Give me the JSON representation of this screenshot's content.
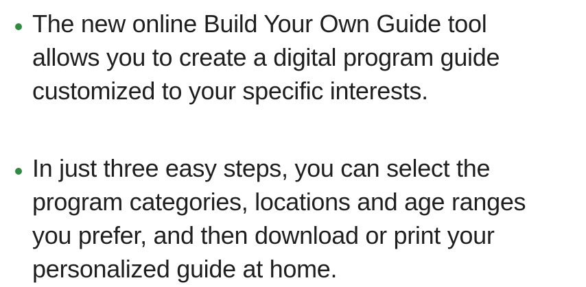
{
  "colors": {
    "bullet": "#2e8b3f",
    "text": "#1f1f1f"
  },
  "bullets": [
    {
      "lines": [
        "The new online Build Your Own Guide tool",
        "allows you to create a digital program guide",
        "customized to your specific interests."
      ]
    },
    {
      "lines": [
        "In just three easy steps, you can select the",
        "program categories, locations and age ranges",
        "you prefer, and then download or print your",
        "personalized guide at home."
      ]
    }
  ]
}
